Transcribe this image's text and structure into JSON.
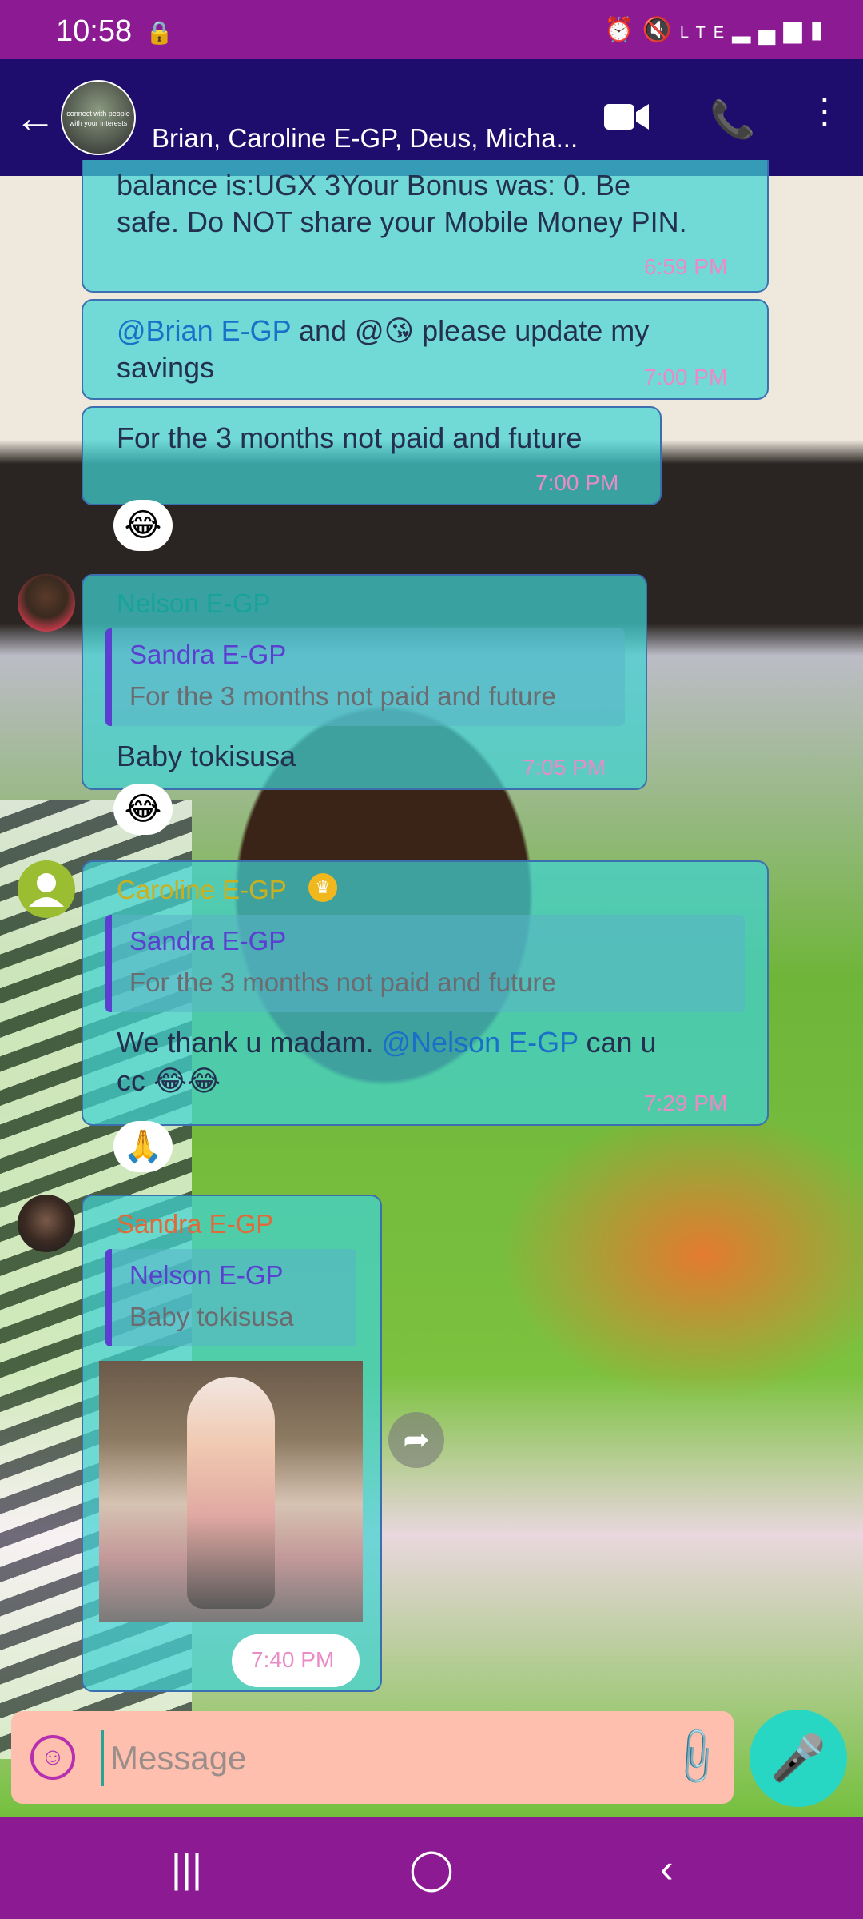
{
  "status": {
    "time": "10:58",
    "network": "LTE"
  },
  "header": {
    "title": "Brian, Caroline E-GP, Deus, Micha...",
    "avatar_text": "connect with people with your interests"
  },
  "messages": [
    {
      "text_line1": "balance is:UGX 3Your Bonus was: 0. Be",
      "text_line2": "safe. Do NOT share your Mobile Money PIN.",
      "time": "6:59 PM"
    },
    {
      "mention": "@Brian E-GP",
      "text_mid": " and @",
      "emoji": "😘",
      "text_end": " please update my",
      "text_line2": "savings",
      "time": "7:00 PM"
    },
    {
      "text": "For the 3 months not paid and future",
      "time": "7:00 PM",
      "reaction": "😂"
    },
    {
      "sender": "Nelson E-GP",
      "quote_name": "Sandra E-GP",
      "quote_text": "For the 3 months not paid and future",
      "text": "Baby tokisusa",
      "time": "7:05 PM",
      "reaction": "😂"
    },
    {
      "sender": "Caroline E-GP",
      "quote_name": "Sandra E-GP",
      "quote_text": "For the 3 months not paid and future",
      "text_start": "We thank u madam. ",
      "mention": "@Nelson E-GP",
      "text_end": "  can u",
      "text_line2": "cc 😂😂",
      "time": "7:29 PM",
      "reaction": "🙏"
    },
    {
      "sender": "Sandra E-GP",
      "quote_name": "Nelson E-GP",
      "quote_text": "Baby tokisusa",
      "time": "7:40 PM"
    }
  ],
  "composer": {
    "placeholder": "Message"
  },
  "icons": {
    "back": "arrow-left",
    "video": "video-camera",
    "phone": "phone",
    "menu": "more-vertical",
    "emoji": "smiley",
    "attach": "paperclip",
    "mic": "microphone",
    "forward": "share-arrow"
  },
  "colors": {
    "statusbar": "#8b1a93",
    "topbar": "#1f0d6e",
    "bubble": "#40d2d2",
    "mention": "#1a6fc8",
    "timestamp": "#e98bc5",
    "composer": "#ffbfae",
    "mic": "#27d6c3",
    "nelson": "#17a39a",
    "caroline": "#c9b01f",
    "sandra": "#e06a3a"
  }
}
